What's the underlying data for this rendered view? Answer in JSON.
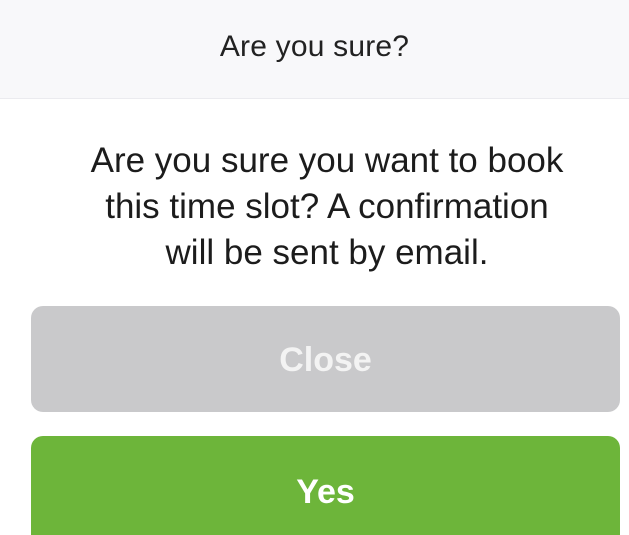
{
  "dialog": {
    "title": "Are you sure?",
    "message_lines": [
      "Are you sure you want to book",
      "this time slot? A confirmation",
      "will be sent by email."
    ],
    "close_label": "Close",
    "yes_label": "Yes"
  },
  "colors": {
    "header_bg": "#f8f8fa",
    "close_button": "#c9c9cb",
    "yes_button": "#6db53a"
  }
}
